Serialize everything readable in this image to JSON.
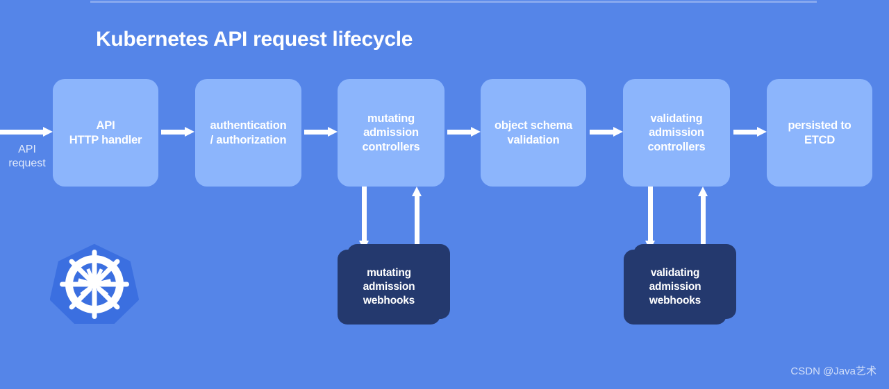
{
  "title": "Kubernetes API request lifecycle",
  "background_color": "#5585e8",
  "stage_box_color": "#8cb5fc",
  "webhook_box_color": "#24396e",
  "arrow_color": "#ffffff",
  "entry": {
    "label": "API\nrequest"
  },
  "stages": [
    {
      "id": "api-http-handler",
      "label": "API\nHTTP handler"
    },
    {
      "id": "authentication-authorization",
      "label": "authentication\n/ authorization"
    },
    {
      "id": "mutating-admission-controllers",
      "label": "mutating\nadmission\ncontrollers"
    },
    {
      "id": "object-schema-validation",
      "label": "object schema\nvalidation"
    },
    {
      "id": "validating-admission-controllers",
      "label": "validating\nadmission\ncontrollers"
    },
    {
      "id": "persisted-to-etcd",
      "label": "persisted to\nETCD"
    }
  ],
  "webhooks": [
    {
      "id": "mutating-admission-webhooks",
      "label": "mutating\nadmission\nwebhooks"
    },
    {
      "id": "validating-admission-webhooks",
      "label": "validating\nadmission\nwebhooks"
    }
  ],
  "logo": {
    "name": "kubernetes-logo",
    "shape": "heptagon-helm-wheel",
    "fill": "#326ce5",
    "glyph_color": "#ffffff"
  },
  "watermark": "CSDN @Java艺术"
}
